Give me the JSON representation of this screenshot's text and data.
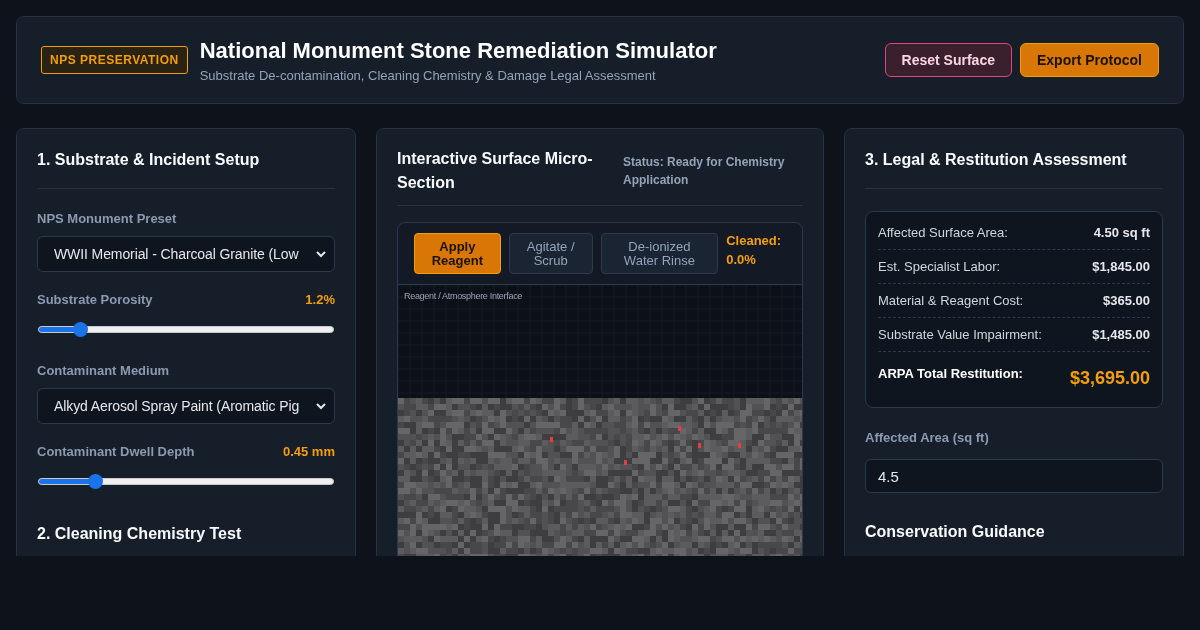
{
  "header": {
    "badge": "NPS PRESERVATION",
    "title": "National Monument Stone Remediation Simulator",
    "subtitle": "Substrate De-contamination, Cleaning Chemistry & Damage Legal Assessment",
    "buttons": [
      {
        "label": "Reset Surface",
        "kind": "danger"
      },
      {
        "label": "Export Protocol",
        "kind": "primary"
      }
    ]
  },
  "setup": {
    "title": "1. Substrate & Incident Setup",
    "fields": [
      {
        "kind": "select",
        "label": "NPS Monument Preset",
        "value": "WWII Memorial - Charcoal Granite (Low"
      },
      {
        "kind": "slider",
        "label": "Substrate Porosity",
        "reading": "1.2%",
        "level": 0.14
      },
      {
        "kind": "select",
        "label": "Contaminant Medium",
        "value": "Alkyd Aerosol Spray Paint (Aromatic Pig"
      },
      {
        "kind": "slider",
        "label": "Contaminant Dwell Depth",
        "reading": "0.45 mm",
        "level": 0.19
      }
    ],
    "next_title": "2. Cleaning Chemistry Test"
  },
  "surface": {
    "title": "Interactive Surface Micro-Section",
    "status": "Status: Ready for Chemistry Application",
    "tabs": [
      {
        "label": "Apply Reagent",
        "selected": true
      },
      {
        "label": "Agitate / Scrub",
        "selected": false
      },
      {
        "label": "De-ionized Water Rinse",
        "selected": false
      }
    ],
    "cleaned": "Cleaned: 0.0%",
    "interface_label": "Reagent / Atmosphere Interface"
  },
  "legal": {
    "title": "3. Legal & Restitution Assessment",
    "rows": [
      {
        "label": "Affected Surface Area:",
        "value": "4.50 sq ft"
      },
      {
        "label": "Est. Specialist Labor:",
        "value": "$1,845.00"
      },
      {
        "label": "Material & Reagent Cost:",
        "value": "$365.00"
      },
      {
        "label": "Substrate Value Impairment:",
        "value": "$1,485.00"
      }
    ],
    "total": {
      "label": "ARPA Total Restitution:",
      "value": "$3,695.00"
    },
    "area_field": {
      "label": "Affected Area (sq ft)",
      "value": "4.5"
    },
    "guidance_title": "Conservation Guidance"
  }
}
